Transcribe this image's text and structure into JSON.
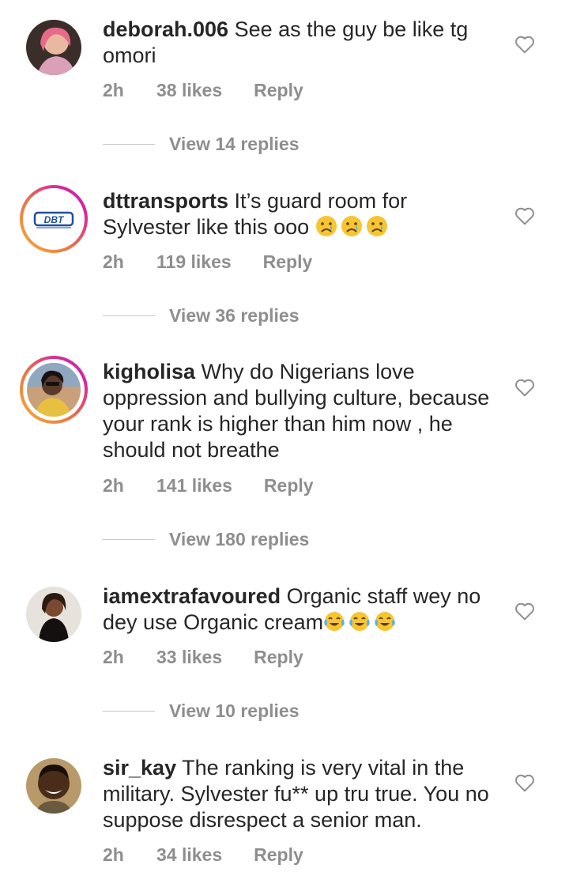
{
  "comments": [
    {
      "username": "deborah.006",
      "text": "See as the guy be like tg omori",
      "time": "2h",
      "likes": "38 likes",
      "reply": "Reply",
      "view_replies": "View 14 replies"
    },
    {
      "username": "dttransports",
      "text": "It’s guard room for Sylvester like this ooo",
      "emoji": "crying-face",
      "time": "2h",
      "likes": "119 likes",
      "reply": "Reply",
      "view_replies": "View 36 replies",
      "avatar_logo": "DBT"
    },
    {
      "username": "kigholisa",
      "text": "Why do Nigerians love oppression and bullying culture, because your rank is higher than him now , he should not breathe",
      "time": "2h",
      "likes": "141 likes",
      "reply": "Reply",
      "view_replies": "View 180 replies"
    },
    {
      "username": "iamextrafavoured",
      "text": "Organic staff wey no dey use Organic cream",
      "emoji": "tears-of-joy",
      "time": "2h",
      "likes": "33 likes",
      "reply": "Reply",
      "view_replies": "View 10 replies"
    },
    {
      "username": "sir_kay",
      "text": "The ranking is very vital in the military. Sylvester fu** up tru true. You no suppose disrespect a senior man.",
      "time": "2h",
      "likes": "34 likes",
      "reply": "Reply"
    }
  ],
  "colors": {
    "text": "#262626",
    "muted": "#8e8e8e",
    "story_ring": "#d6249f"
  }
}
